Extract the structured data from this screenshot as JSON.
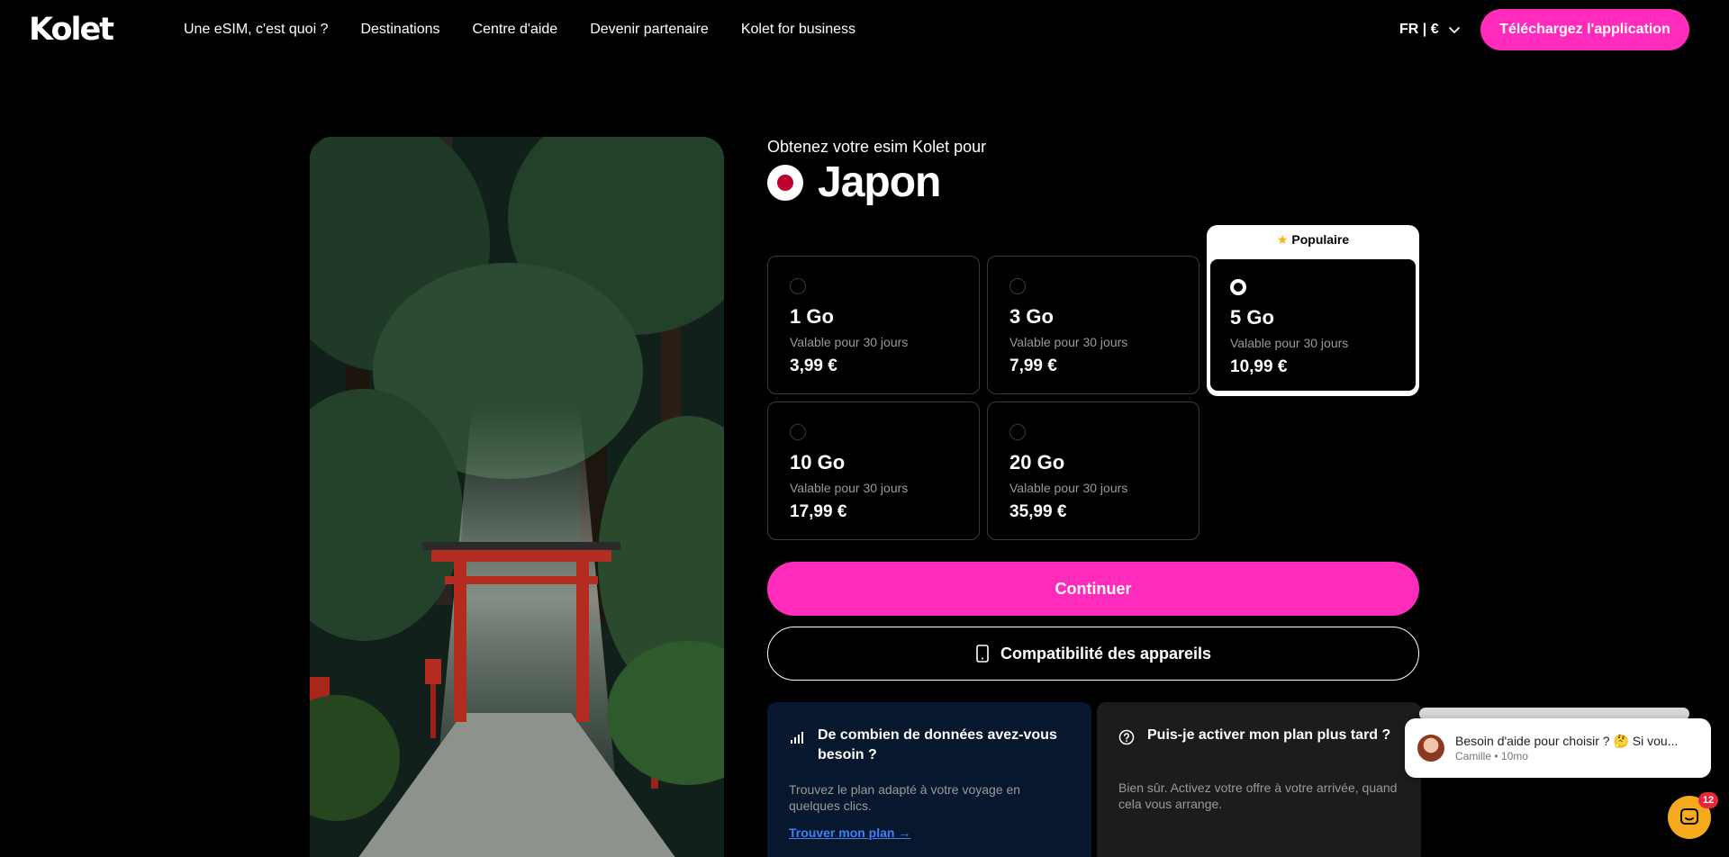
{
  "header": {
    "logo": "Kolet",
    "nav": [
      "Une eSIM, c'est quoi ?",
      "Destinations",
      "Centre d'aide",
      "Devenir partenaire",
      "Kolet for business"
    ],
    "lang": "FR | €",
    "download_label": "Téléchargez l'application"
  },
  "product": {
    "kicker": "Obtenez votre esim Kolet pour",
    "country": "Japon",
    "popular_label": "Populaire",
    "plans": [
      {
        "gb": "1 Go",
        "validity": "Valable pour 30 jours",
        "price": "3,99 €"
      },
      {
        "gb": "3 Go",
        "validity": "Valable pour 30 jours",
        "price": "7,99 €"
      },
      {
        "gb": "5 Go",
        "validity": "Valable pour 30 jours",
        "price": "10,99 €"
      },
      {
        "gb": "10 Go",
        "validity": "Valable pour 30 jours",
        "price": "17,99 €"
      },
      {
        "gb": "20 Go",
        "validity": "Valable pour 30 jours",
        "price": "35,99 €"
      }
    ],
    "selected_plan": "5 Go",
    "continue_label": "Continuer",
    "compat_label": "Compatibilité des appareils"
  },
  "info_cards": [
    {
      "title": "De combien de données avez-vous besoin ?",
      "text": "Trouvez le plan adapté à votre voyage en quelques clics.",
      "link": "Trouver mon plan →"
    },
    {
      "title": "Puis-je activer mon plan plus tard ?",
      "text": "Bien sûr. Activez votre offre à votre arrivée, quand cela vous arrange."
    }
  ],
  "chat": {
    "message": "Besoin d'aide pour choisir ? 🤔 Si vou...",
    "author": "Camille",
    "separator": "•",
    "time": "10mo",
    "badge": "12"
  },
  "colors": {
    "accent": "#ff2bbd",
    "background": "#000000",
    "info_blue": "#07172e",
    "info_gray": "#1c1c1c",
    "chat_launcher": "#f7a91e"
  },
  "icons": [
    "chevron-down-icon",
    "phone-icon",
    "signal-bars-icon",
    "question-circle-icon",
    "chat-icon",
    "star-icon"
  ]
}
